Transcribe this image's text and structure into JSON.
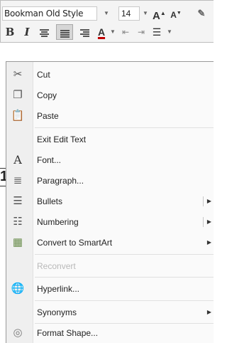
{
  "mini_toolbar": {
    "font_name": "Bookman Old Style",
    "font_size": "14",
    "grow_font_icon": "grow-font-icon",
    "shrink_font_icon": "shrink-font-icon",
    "bold": "B",
    "italic": "I",
    "font_color": "A",
    "colors": {
      "font_color_bar": "#c00000",
      "active_bg": "#d6d6d6"
    }
  },
  "context_menu": {
    "items": [
      {
        "label": "Cut",
        "mnemonic": "t",
        "icon": "scissors-icon",
        "enabled": true
      },
      {
        "label": "Copy",
        "mnemonic": "C",
        "icon": "copy-icon",
        "enabled": true
      },
      {
        "label": "Paste",
        "mnemonic": "P",
        "icon": "paste-icon",
        "enabled": true
      },
      {
        "label": "Exit Edit Text",
        "mnemonic": "x",
        "icon": "",
        "enabled": true
      },
      {
        "label": "Font...",
        "mnemonic": "F",
        "icon": "font-icon",
        "enabled": true
      },
      {
        "label": "Paragraph...",
        "mnemonic": "P",
        "icon": "paragraph-icon",
        "enabled": true
      },
      {
        "label": "Bullets",
        "mnemonic": "B",
        "icon": "bullets-icon",
        "enabled": true,
        "submenu": true
      },
      {
        "label": "Numbering",
        "mnemonic": "N",
        "icon": "numbering-icon",
        "enabled": true,
        "submenu": true
      },
      {
        "label": "Convert to SmartArt",
        "mnemonic": "M",
        "icon": "smartart-icon",
        "enabled": true,
        "submenu": true
      },
      {
        "label": "Reconvert",
        "mnemonic": "",
        "icon": "",
        "enabled": false
      },
      {
        "label": "Hyperlink...",
        "mnemonic": "H",
        "icon": "hyperlink-icon",
        "enabled": true
      },
      {
        "label": "Synonyms",
        "mnemonic": "y",
        "icon": "",
        "enabled": true,
        "submenu": true
      },
      {
        "label": "Format Shape...",
        "mnemonic": "o",
        "icon": "format-shape-icon",
        "enabled": true
      }
    ]
  },
  "side_clip": {
    "glyph": "1"
  }
}
